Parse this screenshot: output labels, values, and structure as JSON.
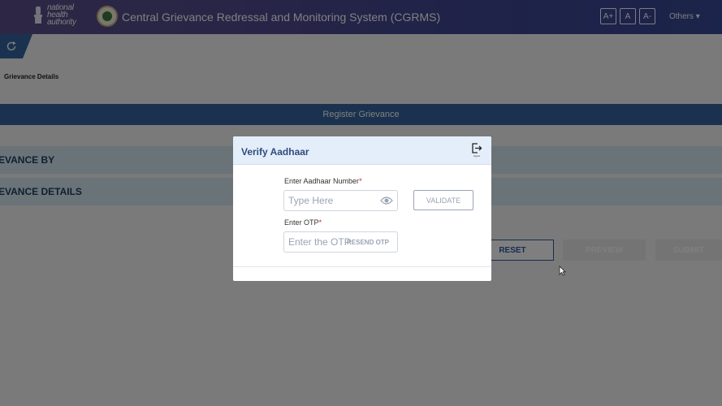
{
  "header": {
    "org_logo_text_lines": [
      "national",
      "health",
      "authority"
    ],
    "app_title": "Central Grievance Redressal and Monitoring System (CGRMS)",
    "font_buttons": [
      "A+",
      "A",
      "A-"
    ],
    "others_menu": "Others ▾"
  },
  "page": {
    "section_label": "Grievance Details",
    "register_bar": "Register Grievance",
    "sections": [
      "EVANCE BY",
      "EVANCE DETAILS"
    ],
    "buttons": {
      "reset": "RESET",
      "preview": "PREVIEW",
      "submit": "SUBMIT"
    }
  },
  "modal": {
    "title": "Verify Aadhaar",
    "logout_label": "logout",
    "aadhaar": {
      "label": "Enter Aadhaar Number",
      "required_mark": "*",
      "placeholder": "Type Here"
    },
    "validate_button": "VALIDATE",
    "otp": {
      "label": "Enter OTP",
      "required_mark": "*",
      "placeholder": "Enter the OTP",
      "resend_label": "RESEND OTP"
    }
  },
  "colors": {
    "header_gradient_start": "#5b4f8a",
    "header_gradient_end": "#374896",
    "register_bar": "#35659e",
    "section_bar": "#d5e6ee",
    "modal_header": "#e4eefa",
    "required": "#c62828"
  },
  "icons": [
    "emblem-icon",
    "seal-icon",
    "refresh-icon",
    "logout-icon",
    "eye-icon",
    "cursor-icon"
  ]
}
